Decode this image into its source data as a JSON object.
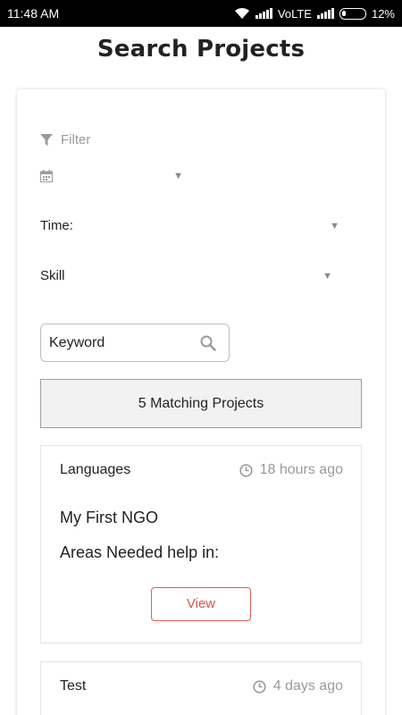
{
  "status_bar": {
    "time": "11:48 AM",
    "network": "VoLTE",
    "battery": "12%",
    "icons": [
      "wifi-icon",
      "signal-icon",
      "battery-icon"
    ]
  },
  "page": {
    "title": "Search Projects"
  },
  "filters": {
    "filter_label": "Filter",
    "date_value": "",
    "time_label": "Time:",
    "skill_label": "Skill",
    "keyword_placeholder": "Keyword"
  },
  "results": {
    "count_label": "5 Matching Projects"
  },
  "projects": [
    {
      "skill": "Languages",
      "time_ago": "18 hours ago",
      "name": "My First NGO",
      "areas": "Areas Needed help in:",
      "view_label": "View"
    },
    {
      "skill": "Test",
      "time_ago": "4 days ago"
    }
  ],
  "colors": {
    "accent": "#d9534f",
    "muted": "#9a9a9a",
    "status_bar": "#000000"
  }
}
